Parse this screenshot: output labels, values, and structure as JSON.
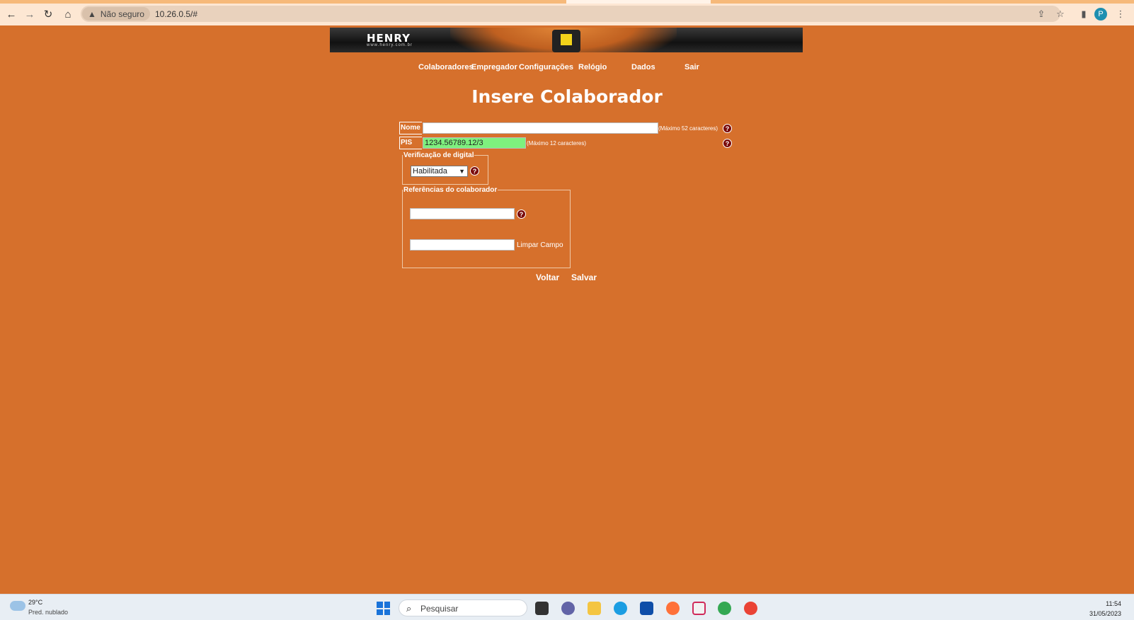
{
  "browser": {
    "security_label": "Não seguro",
    "url": "10.26.0.5/#",
    "profile_initial": "P"
  },
  "banner": {
    "logo": "HENRY",
    "site": "www.henry.com.br"
  },
  "menu": [
    {
      "label": "Colaboradores"
    },
    {
      "label": "Empregador"
    },
    {
      "label": "Configurações"
    },
    {
      "label": "Relógio"
    },
    {
      "label": "Dados"
    },
    {
      "label": "Sair"
    }
  ],
  "page": {
    "title": "Insere Colaborador"
  },
  "form": {
    "nome": {
      "label": "Nome",
      "value": "",
      "note": "(Máximo 52 caracteres)"
    },
    "pis": {
      "label": "PIS",
      "value": "1234.56789.12/3",
      "note": "(Máximo 12 caracteres)"
    },
    "verificacao": {
      "legend": "Verificação de digital",
      "selected": "Habilitada"
    },
    "referencias": {
      "legend": "Referências do colaborador",
      "ref1": "",
      "ref2": "",
      "clear_label": "Limpar Campo"
    },
    "help_glyph": "?"
  },
  "actions": {
    "back": "Voltar",
    "save": "Salvar"
  },
  "taskbar": {
    "weather_temp": "29°C",
    "weather_desc": "Pred. nublado",
    "search_placeholder": "Pesquisar",
    "time": "11:54",
    "date": "31/05/2023"
  }
}
